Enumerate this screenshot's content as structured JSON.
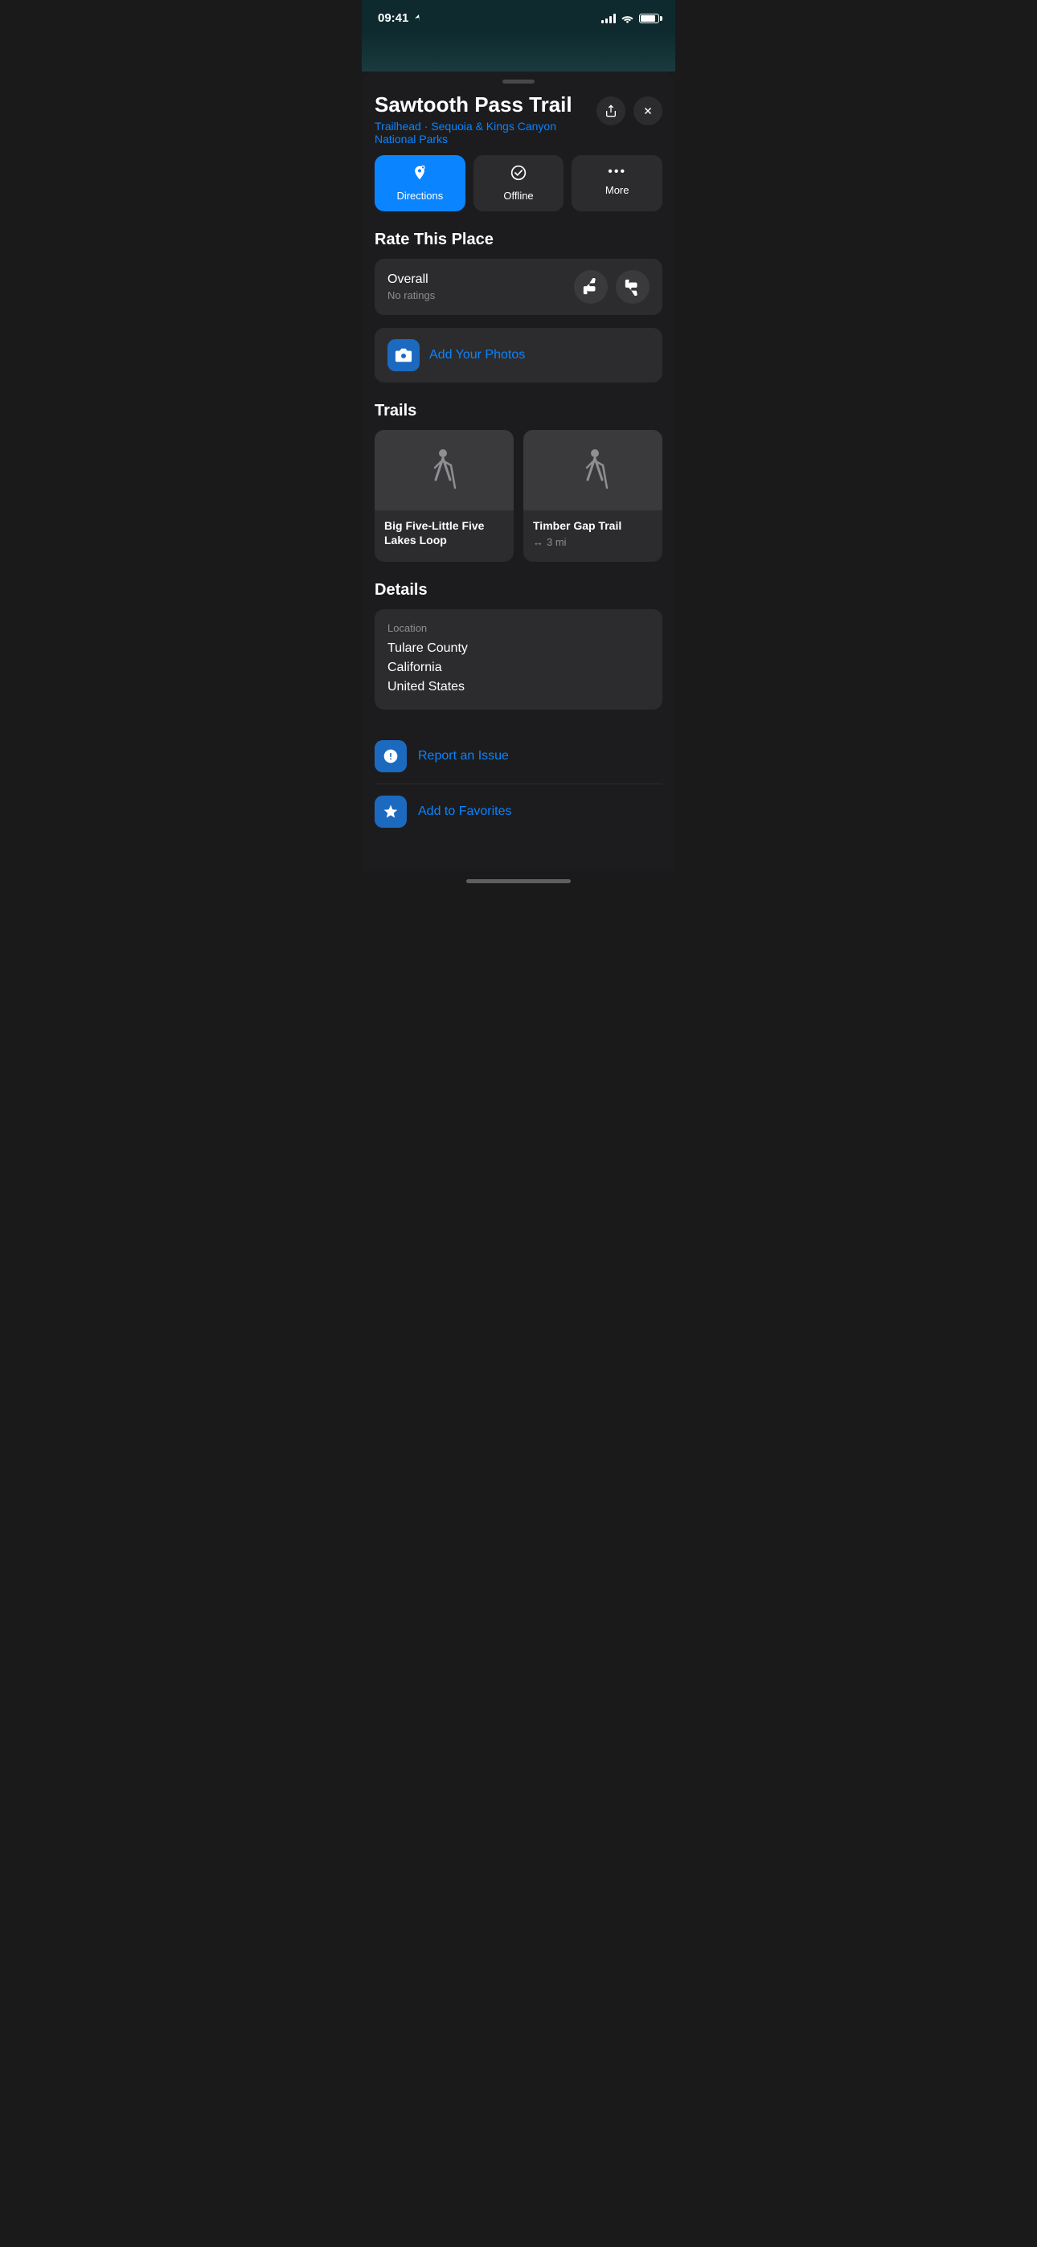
{
  "statusBar": {
    "time": "09:41",
    "locationActive": true
  },
  "header": {
    "title": "Sawtooth Pass Trail",
    "subtitle": "Trailhead",
    "subtitleLink": "Sequoia & Kings Canyon National Parks",
    "shareLabel": "share",
    "closeLabel": "close"
  },
  "actionButtons": {
    "directions": {
      "label": "Directions",
      "icon": "↗"
    },
    "offline": {
      "label": "Offline",
      "icon": "✓"
    },
    "more": {
      "label": "More",
      "icon": "···"
    }
  },
  "rateSection": {
    "title": "Rate This Place",
    "overallLabel": "Overall",
    "noRatings": "No ratings",
    "thumbUpIcon": "👍",
    "thumbDownIcon": "👎"
  },
  "photos": {
    "label": "Add Your Photos",
    "cameraIcon": "📷"
  },
  "trails": {
    "title": "Trails",
    "items": [
      {
        "name": "Big Five-Little Five Lakes Loop",
        "distance": null
      },
      {
        "name": "Timber Gap Trail",
        "distance": "3 mi",
        "distanceIcon": "↔"
      }
    ]
  },
  "details": {
    "title": "Details",
    "locationLabel": "Location",
    "locationLines": [
      "Tulare County",
      "California",
      "United States"
    ]
  },
  "actions": [
    {
      "id": "report",
      "label": "Report an Issue",
      "iconType": "report"
    },
    {
      "id": "favorites",
      "label": "Add to Favorites",
      "iconType": "star"
    }
  ]
}
